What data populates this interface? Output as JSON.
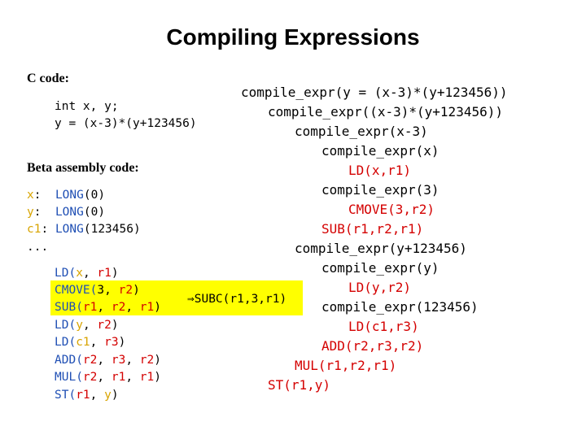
{
  "title": "Compiling Expressions",
  "c_section": {
    "heading": "C code:",
    "lines": [
      "int x, y;",
      "y = (x-3)*(y+123456)"
    ]
  },
  "beta_section": {
    "heading": "Beta assembly code:",
    "data_lines": [
      {
        "label": "x",
        "rest": "LONG(0)",
        "ins": "LONG",
        "arg": "(0)"
      },
      {
        "label": "y",
        "rest": "LONG(0)",
        "ins": "LONG",
        "arg": "(0)"
      },
      {
        "label": "c1",
        "rest": "LONG(123456)",
        "ins": "LONG",
        "arg": "(123456)"
      }
    ],
    "ellipsis": "...",
    "instructions": [
      {
        "op": "LD(",
        "args": [
          "x",
          ", ",
          "r1",
          ")"
        ]
      },
      {
        "op": "CMOVE(",
        "args": [
          "3, ",
          "r2",
          ")"
        ]
      },
      {
        "op": "SUB(",
        "args": [
          "r1",
          ", ",
          "r2",
          ", ",
          "r1",
          ")"
        ]
      },
      {
        "op": "LD(",
        "args": [
          "y",
          ", ",
          "r2",
          ")"
        ]
      },
      {
        "op": "LD(",
        "args": [
          "c1",
          ", ",
          "r3",
          ")"
        ]
      },
      {
        "op": "ADD(",
        "args": [
          "r2",
          ", ",
          "r3",
          ", ",
          "r2",
          ")"
        ]
      },
      {
        "op": "MUL(",
        "args": [
          "r2",
          ", ",
          "r1",
          ", ",
          "r1",
          ")"
        ]
      },
      {
        "op": "ST(",
        "args": [
          "r1",
          ", ",
          "y",
          ")"
        ]
      }
    ],
    "highlight_note": "⇒SUBC(r1,3,r1)"
  },
  "trace": [
    {
      "text": "compile_expr(y = (x-3)*(y+123456))",
      "color": "black"
    },
    {
      "text": "compile_expr((x-3)*(y+123456))",
      "color": "black"
    },
    {
      "text": "compile_expr(x-3)",
      "color": "black"
    },
    {
      "text": "compile_expr(x)",
      "color": "black"
    },
    {
      "text": "LD(x,r1)",
      "color": "red"
    },
    {
      "text": "compile_expr(3)",
      "color": "black"
    },
    {
      "text": "CMOVE(3,r2)",
      "color": "red"
    },
    {
      "text": "SUB(r1,r2,r1)",
      "color": "red"
    },
    {
      "text": "compile_expr(y+123456)",
      "color": "black"
    },
    {
      "text": "compile_expr(y)",
      "color": "black"
    },
    {
      "text": "LD(y,r2)",
      "color": "red"
    },
    {
      "text": "compile_expr(123456)",
      "color": "black"
    },
    {
      "text": "LD(c1,r3)",
      "color": "red"
    },
    {
      "text": "ADD(r2,r3,r2)",
      "color": "red"
    },
    {
      "text": "MUL(r1,r2,r1)",
      "color": "red"
    },
    {
      "text": "ST(r1,y)",
      "color": "red"
    }
  ],
  "colors": {
    "blue": "#1f4fb4",
    "red": "#d40000",
    "label_gold": "#d8a400",
    "highlight": "#ffff00"
  }
}
